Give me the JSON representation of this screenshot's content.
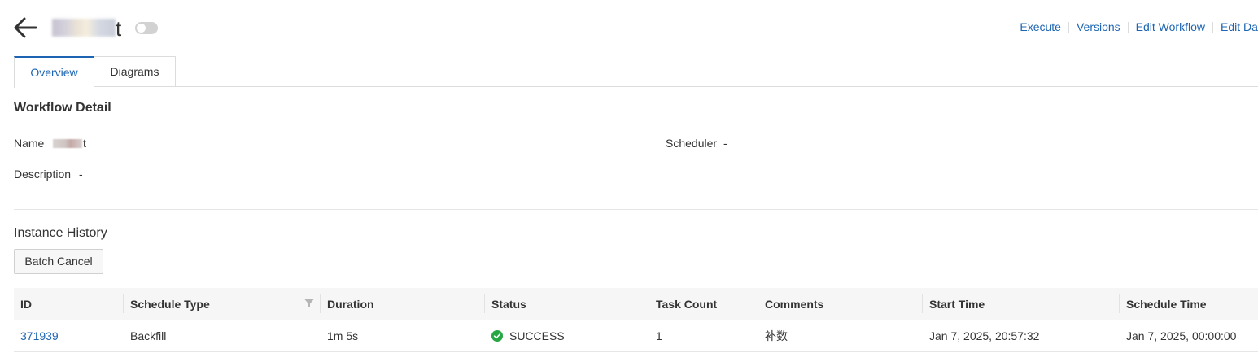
{
  "header": {
    "title": "t",
    "toggle_on": false,
    "actions": [
      "Execute",
      "Versions",
      "Edit Workflow",
      "Edit Da"
    ]
  },
  "tabs": [
    {
      "label": "Overview",
      "active": true
    },
    {
      "label": "Diagrams",
      "active": false
    }
  ],
  "detail": {
    "title": "Workflow Detail",
    "name_label": "Name",
    "name_value": "t",
    "scheduler_label": "Scheduler",
    "scheduler_value": "-",
    "description_label": "Description",
    "description_value": "-"
  },
  "history": {
    "title": "Instance History",
    "batch_cancel_label": "Batch Cancel",
    "columns": [
      "ID",
      "Schedule Type",
      "Duration",
      "Status",
      "Task Count",
      "Comments",
      "Start Time",
      "Schedule Time"
    ],
    "rows": [
      {
        "id": "371939",
        "schedule_type": "Backfill",
        "duration": "1m 5s",
        "status": "SUCCESS",
        "task_count": "1",
        "comments": "补数",
        "start_time": "Jan 7, 2025, 20:57:32",
        "schedule_time": "Jan 7, 2025, 00:00:00"
      }
    ]
  },
  "colors": {
    "link": "#1d65b3",
    "success": "#27a744",
    "toggle_off": "#d2d2d2"
  }
}
